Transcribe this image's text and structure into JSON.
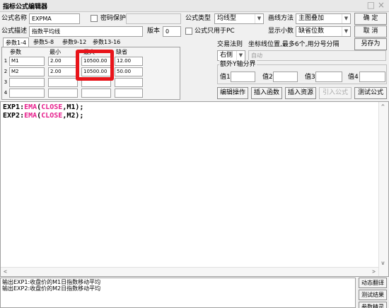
{
  "window": {
    "title": "指标公式编辑器",
    "close_glyph": "□ ×"
  },
  "row1": {
    "name_label": "公式名称",
    "name_value": "EXPMA",
    "password_label": "密码保护",
    "type_label": "公式类型",
    "type_value": "均线型",
    "draw_label": "画线方法",
    "draw_value": "主图叠加",
    "confirm_btn": "确  定"
  },
  "row2": {
    "desc_label": "公式描述",
    "desc_value": "指数平均线",
    "version_label": "版本",
    "version_value": "0",
    "pc_only_label": "公式只用于PC",
    "decimals_label": "显示小数",
    "decimals_value": "缺省位数",
    "cancel_btn": "取  消"
  },
  "tabs": [
    "参数1-4",
    "参数5-8",
    "参数9-12",
    "参数13-16"
  ],
  "params": {
    "headers": [
      "参数",
      "最小",
      "最大",
      "缺省"
    ],
    "rows": [
      {
        "n": "1",
        "name": "M1",
        "min": "2.00",
        "max": "10500.00",
        "def": "12.00"
      },
      {
        "n": "2",
        "name": "M2",
        "min": "2.00",
        "max": "10500.00",
        "def": "50.00"
      },
      {
        "n": "3",
        "name": "",
        "min": "",
        "max": "",
        "def": ""
      },
      {
        "n": "4",
        "name": "",
        "min": "",
        "max": "",
        "def": ""
      }
    ]
  },
  "right": {
    "trade_rule_label": "交易法则",
    "coord_label": "坐标线位置,最多6个,用分号分隔",
    "saveas_btn": "另存为",
    "position_value": "右侧",
    "coord_value": "自动",
    "extra_axis_label": "额外Y轴分界",
    "values": [
      "值1",
      "值2",
      "值3",
      "值4"
    ],
    "buttons": [
      "编辑操作",
      "插入函数",
      "插入资源",
      "引入公式",
      "测试公式"
    ]
  },
  "editor": {
    "lines": [
      {
        "a": "EXP1:",
        "fn": "EMA",
        "b": "(",
        "c": "CLOSE",
        "d": ",M1);"
      },
      {
        "a": "EXP2:",
        "fn": "EMA",
        "b": "(",
        "c": "CLOSE",
        "d": ",M2);"
      }
    ]
  },
  "output": {
    "lines": [
      "输出EXP1:收盘价的M1日指数移动平均",
      "输出EXP2:收盘价的M2日指数移动平均"
    ],
    "buttons": [
      "动态翻译",
      "测试结果",
      "参数精灵"
    ]
  },
  "colors": {
    "highlight": "#e8141a",
    "keyword": "#e61e8c"
  }
}
